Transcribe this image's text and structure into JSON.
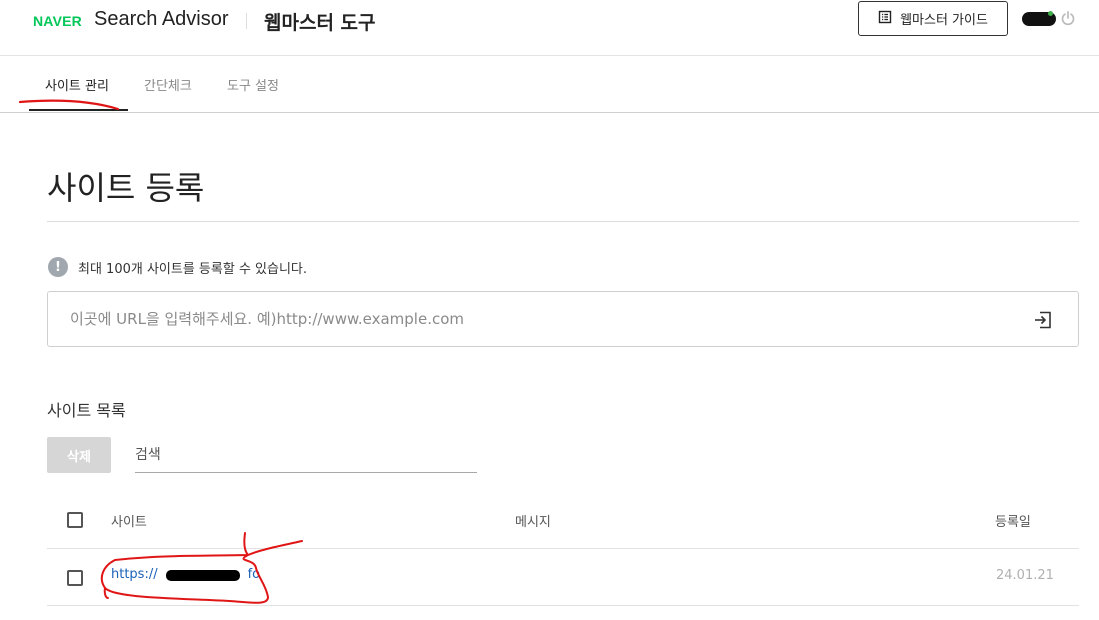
{
  "header": {
    "brand": "NAVER",
    "product": "Search Advisor",
    "subtitle": "웹마스터 도구",
    "guide_button": "웹마스터 가이드",
    "icons": {
      "guide": "book-icon",
      "logout": "power-icon"
    }
  },
  "tabs": [
    {
      "label": "사이트 관리",
      "active": true
    },
    {
      "label": "간단체크",
      "active": false
    },
    {
      "label": "도구 설정",
      "active": false
    }
  ],
  "page": {
    "title": "사이트 등록",
    "info_text": "최대 100개 사이트를 등록할 수 있습니다.",
    "info_icon": "!",
    "url_input": {
      "value": "",
      "placeholder": "이곳에 URL을 입력해주세요. 예)http://www.example.com"
    }
  },
  "site_list": {
    "title": "사이트 목록",
    "delete_button": "삭제",
    "search_placeholder": "검색",
    "columns": {
      "site": "사이트",
      "message": "메시지",
      "date": "등록일"
    },
    "rows": [
      {
        "site": "https://",
        "site_suffix": "fo",
        "message": "",
        "date": "24.01.21",
        "checked": false
      }
    ]
  },
  "colors": {
    "brand_green": "#03c75a",
    "link": "#1b62b8",
    "annotation_red": "#e01515",
    "disabled_button": "#d6d6d6"
  }
}
